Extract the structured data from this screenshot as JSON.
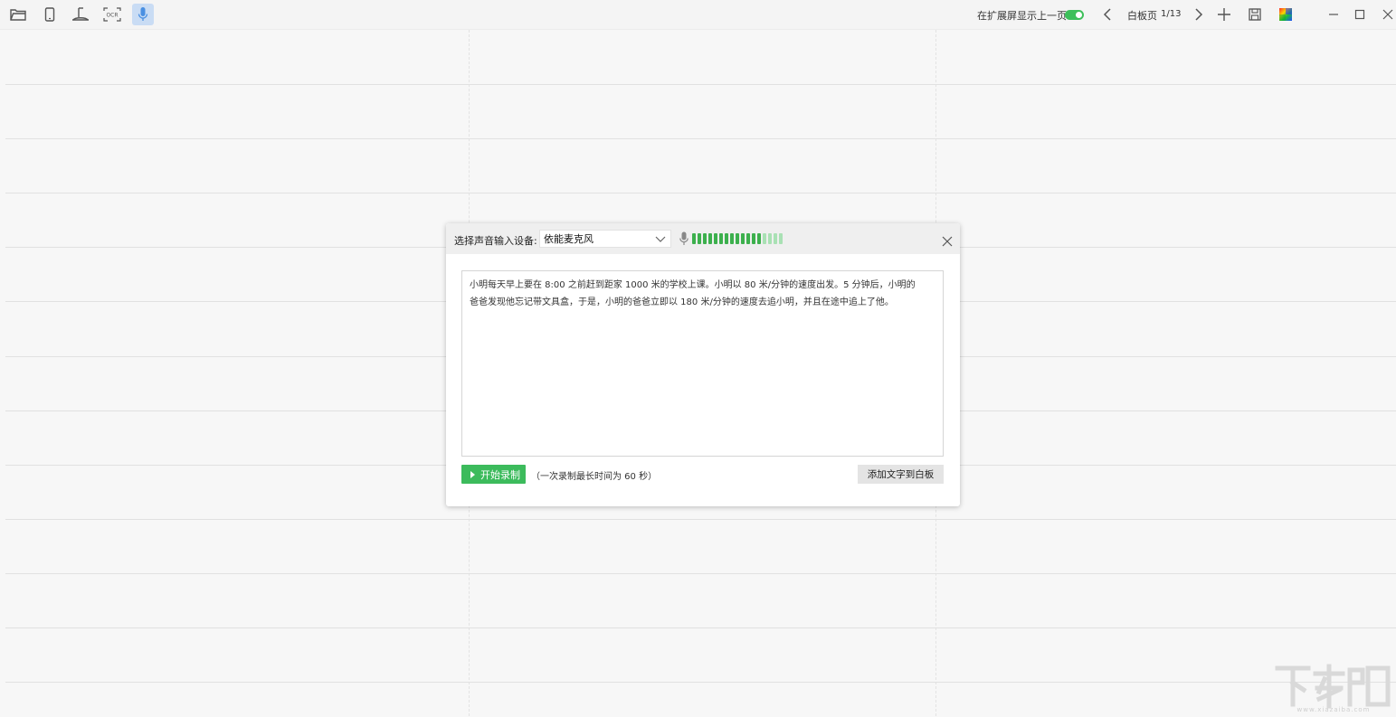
{
  "toolbar": {
    "left_icons": [
      "open-folder-icon",
      "phone-icon",
      "projector-icon",
      "ocr-icon",
      "microphone-icon"
    ],
    "ocr_text": "OCR",
    "extend_screen_label": "在扩展屏显示上一页",
    "extend_screen_toggle": true,
    "page_label": "白板页",
    "page_counter": "1/13",
    "right_icons": [
      "prev-page-icon",
      "next-page-icon",
      "add-page-icon",
      "save-icon",
      "color-palette-icon",
      "minimize-icon",
      "maximize-icon",
      "close-icon"
    ]
  },
  "dialog": {
    "device_label": "选择声音输入设备:",
    "device_value": "依能麦克风",
    "meter": {
      "active_bars": 13,
      "total_bars": 17,
      "active_color": "#3cb04d",
      "inactive_color": "#a9e1b4"
    },
    "transcript_line1": "小明每天早上要在 8:00 之前赶到距家 1000 米的学校上课。小明以 80 米/分钟的速度出发。5 分钟后，小明的",
    "transcript_line2": "爸爸发现他忘记带文具盒，于是，小明的爸爸立即以 180 米/分钟的速度去追小明，并且在途中追上了他。",
    "record_button": "开始录制",
    "record_hint": "（一次录制最长时间为 60 秒）",
    "add_text_button": "添加文字到白板"
  },
  "colors": {
    "accent_green": "#3cbb5c",
    "active_icon_bg": "#c9dcf4",
    "mic_blue": "#4a90e2"
  }
}
